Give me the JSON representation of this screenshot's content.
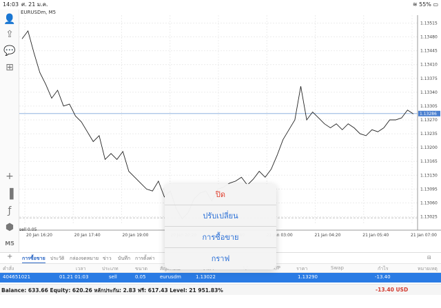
{
  "status": {
    "time": "14:03",
    "date": "ศ. 21 ม.ค.",
    "battery_text": "55%"
  },
  "left_toolbar": {
    "items": [
      {
        "name": "account-icon",
        "glyph": "👤"
      },
      {
        "name": "order-icon",
        "glyph": "⇪"
      },
      {
        "name": "chat-icon",
        "glyph": "💬"
      },
      {
        "name": "new-chart-icon",
        "glyph": "⊞"
      },
      {
        "name": "crosshair-icon",
        "glyph": "+"
      },
      {
        "name": "indicator-icon",
        "glyph": "▐"
      },
      {
        "name": "function-icon",
        "glyph": "ƒ"
      },
      {
        "name": "objects-icon",
        "glyph": "⬢"
      },
      {
        "name": "timeframe-label",
        "glyph": "M5"
      },
      {
        "name": "add-icon",
        "glyph": "+"
      }
    ]
  },
  "chart": {
    "symbol_label": "EURUSDm, M5",
    "sell_line_label": "sell 0.05",
    "current_price": "1.13286",
    "y_ticks": [
      "1.13515",
      "1.13480",
      "1.13445",
      "1.13410",
      "1.13375",
      "1.13340",
      "1.13305",
      "1.13270",
      "1.13235",
      "1.13200",
      "1.13165",
      "1.13130",
      "1.13095",
      "1.13060",
      "1.13025"
    ],
    "x_ticks": [
      "20 Jan 16:20",
      "20 Jan 17:40",
      "20 Jan 19:00",
      "20 Jan 20:20",
      "21 Jan 01:40",
      "21 Jan 03:00",
      "21 Jan 04:20",
      "21 Jan 05:40",
      "21 Jan 07:00"
    ]
  },
  "chart_data": {
    "type": "line",
    "title": "EURUSDm, M5",
    "ylim": [
      1.13005,
      1.13535
    ],
    "x_labels": [
      "20 Jan 16:20",
      "20 Jan 17:40",
      "20 Jan 19:00",
      "20 Jan 20:20",
      "21 Jan 01:40",
      "21 Jan 03:00",
      "21 Jan 04:20",
      "21 Jan 05:40",
      "21 Jan 07:00"
    ],
    "series": [
      {
        "values": [
          1.13475,
          1.13495,
          1.1344,
          1.1339,
          1.1336,
          1.13325,
          1.13345,
          1.13305,
          1.1331,
          1.1328,
          1.13265,
          1.1324,
          1.13215,
          1.1323,
          1.1317,
          1.13185,
          1.1317,
          1.1319,
          1.1314,
          1.13125,
          1.1311,
          1.13095,
          1.1309,
          1.13115,
          1.13075,
          1.1309,
          1.13045,
          1.1302,
          1.13035,
          1.1307,
          1.13085,
          1.1309,
          1.13065,
          1.13095,
          1.131,
          1.1311,
          1.13115,
          1.13125,
          1.13105,
          1.1312,
          1.1314,
          1.13125,
          1.13145,
          1.1318,
          1.1322,
          1.13245,
          1.1327,
          1.13355,
          1.1327,
          1.1329,
          1.13275,
          1.1326,
          1.1325,
          1.1326,
          1.13245,
          1.1326,
          1.1325,
          1.13235,
          1.1323,
          1.13245,
          1.1324,
          1.1325,
          1.1327,
          1.1327,
          1.13275,
          1.13295,
          1.13285
        ]
      }
    ],
    "reference_lines": [
      {
        "label": "1.13286",
        "value": 1.13286
      }
    ]
  },
  "tabs": {
    "items": [
      "การซื้อขาย",
      "ประวัติ",
      "กล่องจดหมาย",
      "ข่าว",
      "บันทึก",
      "การตั้งค่า"
    ],
    "active": "การซื้อขาย"
  },
  "table": {
    "headers": [
      "คำสั่ง",
      "เวลา",
      "ประเภท",
      "ขนาด",
      "สัญลักษณ์",
      "ราคา",
      "S/L",
      "T/P",
      "ราคา",
      "Swap",
      "กำไร",
      "หมายเหตุ"
    ],
    "row": {
      "order": "404651021",
      "time": "01.21 01:03",
      "type": "sell",
      "size": "0.05",
      "symbol": "eurusdm",
      "price_open": "1.13022",
      "price_current": "1.13290",
      "profit": "-13.40"
    }
  },
  "balance": {
    "text": "Balance: 633.66 Equity: 620.26 หลักประกัน: 2.83 ฟรี: 617.43 Level: 21 951.83%",
    "pl": "-13.40  USD"
  },
  "menu": {
    "items": [
      {
        "label": "ปิด",
        "color": "#e0402f"
      },
      {
        "label": "ปรับเปลี่ยน",
        "color": "#2a6fd6"
      },
      {
        "label": "การซื้อขาย",
        "color": "#2a6fd6"
      },
      {
        "label": "กราฟ",
        "color": "#2a6fd6"
      }
    ]
  }
}
